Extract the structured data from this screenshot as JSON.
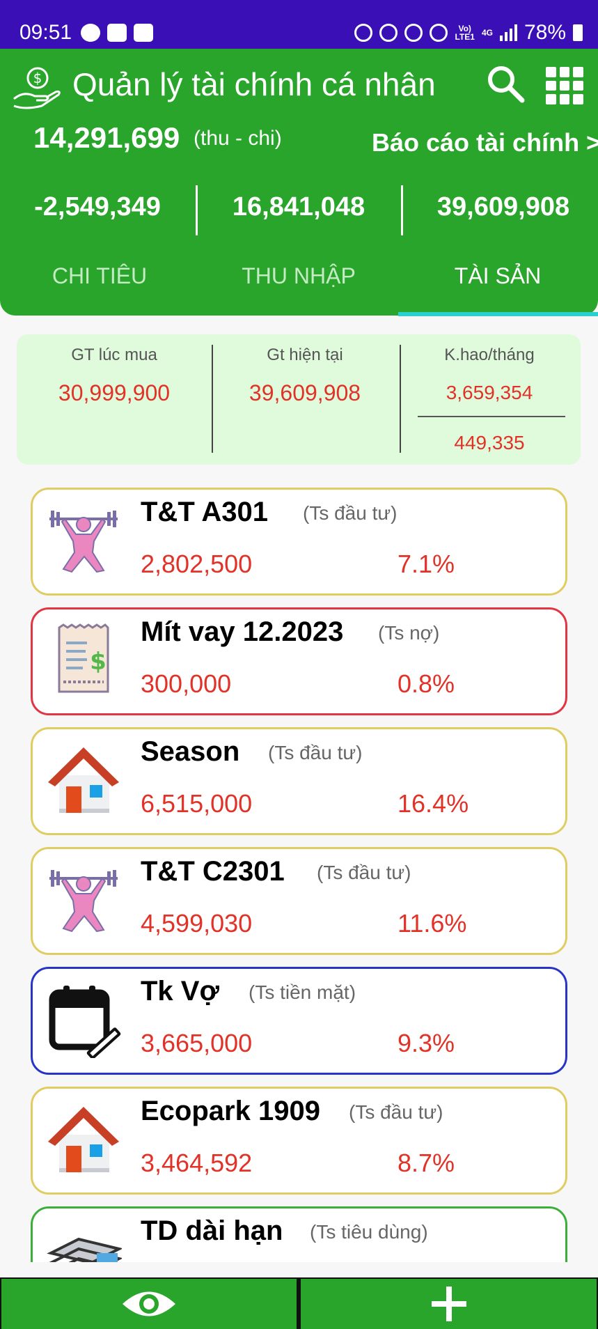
{
  "status_bar": {
    "time": "09:51",
    "battery": "78%",
    "network_top": "Vo)",
    "network_bottom": "LTE1",
    "gen": "4G"
  },
  "header": {
    "title": "Quản lý tài chính cá nhân",
    "balance": "14,291,699",
    "balance_note": "(thu - chi)",
    "report_link": "Báo cáo tài chính >",
    "stats": [
      "-2,549,349",
      "16,841,048",
      "39,609,908"
    ],
    "tabs": [
      {
        "label": "CHI TIÊU"
      },
      {
        "label": "THU NHẬP"
      },
      {
        "label": "TÀI SẢN"
      }
    ]
  },
  "summary": {
    "purchase_label": "GT lúc mua",
    "purchase_value": "30,999,900",
    "current_label": "Gt hiện tại",
    "current_value": "39,609,908",
    "depreciation_label": "K.hao/tháng",
    "depreciation_value": "3,659,354",
    "depreciation_value2": "449,335"
  },
  "assets": [
    {
      "name": "T&T A301",
      "type": "(Ts đầu tư)",
      "amount": "2,802,500",
      "percent": "7.1%",
      "icon": "weightlifter-icon",
      "border": "#e0cd62"
    },
    {
      "name": "Mít vay 12.2023",
      "type": "(Ts nợ)",
      "amount": "300,000",
      "percent": "0.8%",
      "icon": "receipt-icon",
      "border": "#e23443"
    },
    {
      "name": "Season",
      "type": "(Ts đầu tư)",
      "amount": "6,515,000",
      "percent": "16.4%",
      "icon": "house-icon",
      "border": "#e0cd62"
    },
    {
      "name": "T&T C2301",
      "type": "(Ts đầu tư)",
      "amount": "4,599,030",
      "percent": "11.6%",
      "icon": "weightlifter-icon",
      "border": "#e0cd62"
    },
    {
      "name": "Tk Vợ",
      "type": "(Ts tiền mặt)",
      "amount": "3,665,000",
      "percent": "9.3%",
      "icon": "calendar-edit-icon",
      "border": "#2834c8"
    },
    {
      "name": "Ecopark 1909",
      "type": "(Ts đầu tư)",
      "amount": "3,464,592",
      "percent": "8.7%",
      "icon": "house-icon",
      "border": "#e0cd62"
    },
    {
      "name": "TD dài hạn",
      "type": "(Ts tiêu dùng)",
      "amount": "",
      "percent": "",
      "icon": "stack-icon",
      "border": "#3cae3c"
    }
  ],
  "colors": {
    "primary": "#28a52a",
    "status_bar": "#3a0fb6",
    "accent_tab": "#2ad0cf",
    "value_red": "#e23228",
    "summary_bg": "#dffbdc"
  }
}
